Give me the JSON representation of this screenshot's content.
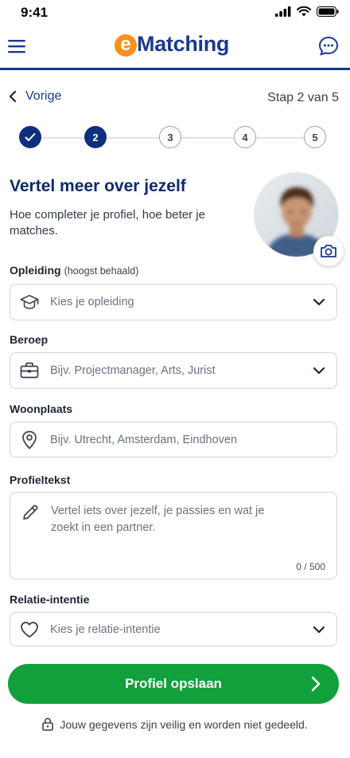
{
  "status": {
    "time": "9:41"
  },
  "header": {
    "brand_initial": "e",
    "brand_name": "Matching"
  },
  "nav": {
    "back_label": "Vorige",
    "step_counter": "Stap 2 van 5"
  },
  "stepper": {
    "steps": [
      {
        "label": "",
        "state": "done"
      },
      {
        "label": "2",
        "state": "active"
      },
      {
        "label": "3",
        "state": "todo"
      },
      {
        "label": "4",
        "state": "todo"
      },
      {
        "label": "5",
        "state": "todo"
      }
    ]
  },
  "intro": {
    "title": "Vertel meer over jezelf",
    "subtitle": "Hoe completer je profiel, hoe beter je matches."
  },
  "form": {
    "education": {
      "label": "Opleiding",
      "hint": "(hoogst behaald)",
      "placeholder": "Kies je opleiding",
      "icon": "graduation-cap-icon"
    },
    "profession": {
      "label": "Beroep",
      "placeholder": "Bijv. Projectmanager, Arts, Jurist",
      "icon": "briefcase-icon"
    },
    "residence": {
      "label": "Woonplaats",
      "placeholder": "Bijv. Utrecht, Amsterdam, Eindhoven",
      "icon": "location-pin-icon"
    },
    "profile_text": {
      "label": "Profieltekst",
      "placeholder": "Vertel iets over jezelf, je passies en wat je zoekt in een partner.",
      "counter": "0 / 500",
      "icon": "pencil-icon"
    },
    "intention": {
      "label": "Relatie-intentie",
      "placeholder": "Kies je relatie-intentie",
      "icon": "heart-icon"
    }
  },
  "actions": {
    "save_label": "Profiel opslaan"
  },
  "footer": {
    "privacy_note": "Jouw gegevens zijn veilig en worden niet gedeeld."
  },
  "colors": {
    "primary": "#0d2f7e",
    "accent": "#f6921e",
    "success": "#11a03c"
  }
}
